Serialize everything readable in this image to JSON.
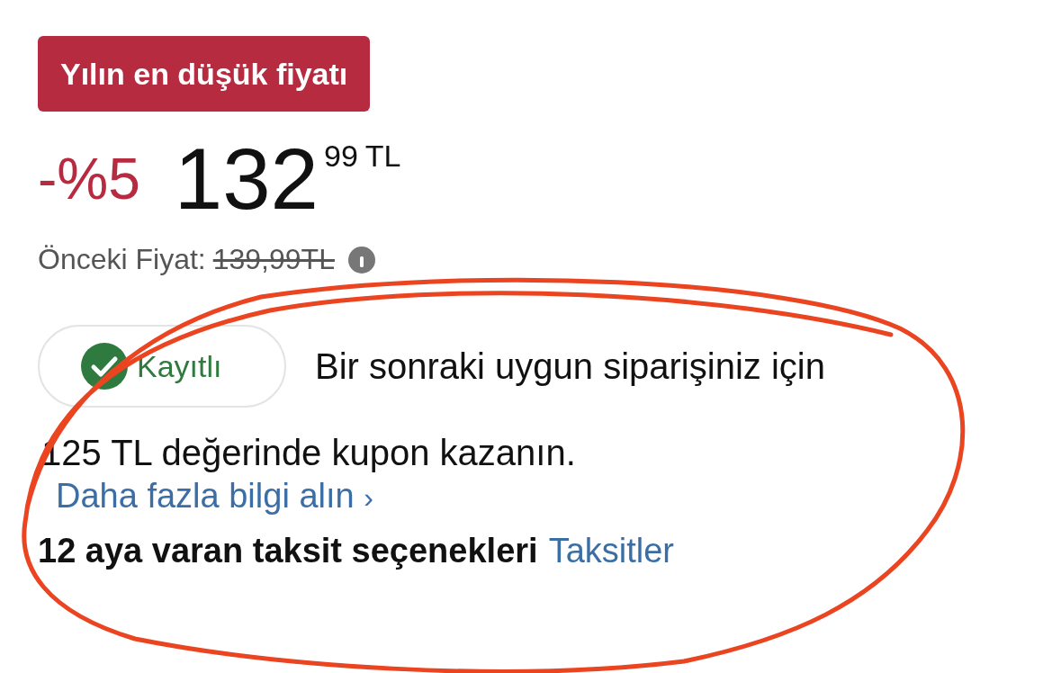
{
  "deal_badge": "Yılın en düşük fiyatı",
  "price": {
    "discount": "-%5",
    "whole": "132",
    "fraction": "99",
    "currency": "TL"
  },
  "previous_price": {
    "label": "Önceki Fiyat:",
    "value": "139,99TL"
  },
  "membership": {
    "label": "Kayıtlı",
    "checked": true
  },
  "coupon_lines": [
    "Bir sonraki uygun siparişiniz için",
    "125 TL değerinde kupon kazanın."
  ],
  "more_info_link": {
    "label": "Daha fazla bilgi alın",
    "chevron": "›"
  },
  "installments": {
    "text": "12 aya varan taksit seçenekleri",
    "link": "Taksitler"
  },
  "annotation": {
    "kind": "ellipse",
    "color": "#ea4420"
  }
}
